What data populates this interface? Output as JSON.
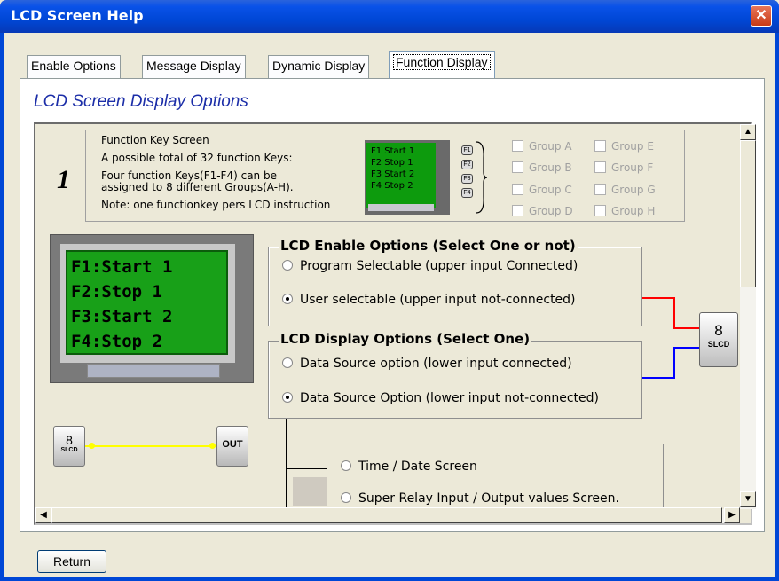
{
  "window": {
    "title": "LCD Screen Help",
    "close_glyph": "✕"
  },
  "tabs": [
    {
      "label": "Enable Options"
    },
    {
      "label": "Message Display"
    },
    {
      "label": "Dynamic Display"
    },
    {
      "label": "Function Display",
      "active": true
    }
  ],
  "panel": {
    "title": "LCD Screen Display Options"
  },
  "info": {
    "number": "1",
    "lines": [
      "Function Key Screen",
      "A possible total of 32 function Keys:",
      "Four function Keys(F1-F4) can be",
      "assigned to 8 different Groups(A-H).",
      "Note: one functionkey pers LCD instruction"
    ],
    "fk_lines": [
      "F1 Start 1",
      "F2 Stop 1",
      "F3 Start 2",
      "F4 Stop 2"
    ],
    "fk_keys": [
      "F1",
      "F2",
      "F3",
      "F4"
    ],
    "groups": [
      "Group A",
      "Group E",
      "Group B",
      "Group F",
      "Group C",
      "Group G",
      "Group D",
      "Group H"
    ]
  },
  "lcd": {
    "lines": [
      "F1:Start 1",
      "F2:Stop 1",
      "F3:Start 2",
      "F4:Stop 2"
    ]
  },
  "enable_options": {
    "title": "LCD Enable Options (Select One or not)",
    "options": [
      "Program Selectable (upper input Connected)",
      "User selectable (upper input not-connected)"
    ],
    "selected_index": 1
  },
  "display_options": {
    "title": "LCD Display Options (Select One)",
    "options": [
      "Data Source option (lower input connected)",
      "Data Source Option (lower input not-connected)"
    ],
    "selected_index": 1
  },
  "screen_options": [
    "Time / Date Screen",
    "Super Relay Input / Output values Screen."
  ],
  "blocks": {
    "slcd_num": "8",
    "slcd_label": "SLCD",
    "small_num": "8",
    "small_label": "SLCD",
    "out_label": "OUT"
  },
  "footer": {
    "return_label": "Return"
  },
  "colors": {
    "red_wire": "#ff0000",
    "blue_wire": "#0000ff",
    "yellow_wire": "#ffff00",
    "lcd_green": "#18a018"
  }
}
